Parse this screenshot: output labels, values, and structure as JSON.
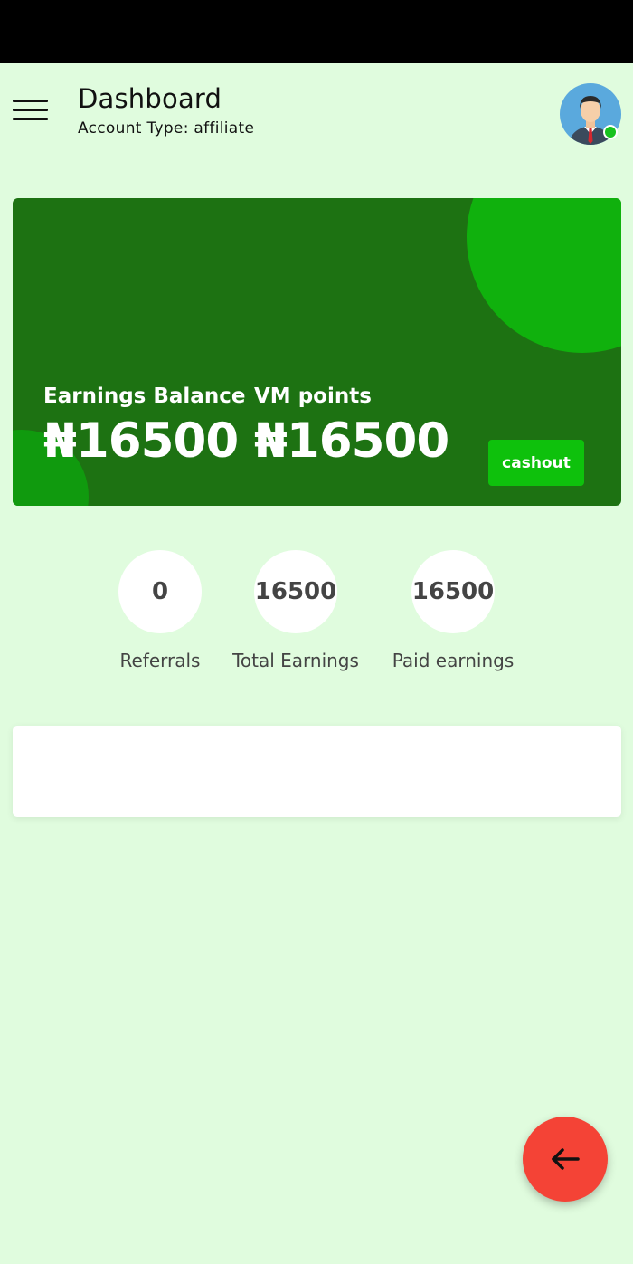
{
  "header": {
    "title": "Dashboard",
    "account_type": "Account Type: affiliate",
    "menu_icon": "hamburger-menu-icon",
    "avatar_icon": "user-avatar-icon",
    "online_status_color": "#17c21e"
  },
  "balance_card": {
    "earnings_label": "Earnings Balance",
    "earnings_value": "₦16500",
    "vm_label": "VM points",
    "vm_value": "₦16500",
    "cashout_label": "cashout",
    "card_color": "#1d7212",
    "accent_color": "#0ec10c"
  },
  "stats": [
    {
      "value": "0",
      "label": "Referrals"
    },
    {
      "value": "16500",
      "label": "Total Earnings"
    },
    {
      "value": "16500",
      "label": "Paid earnings"
    }
  ],
  "fab": {
    "icon": "arrow-left-icon",
    "color": "#f44336"
  }
}
